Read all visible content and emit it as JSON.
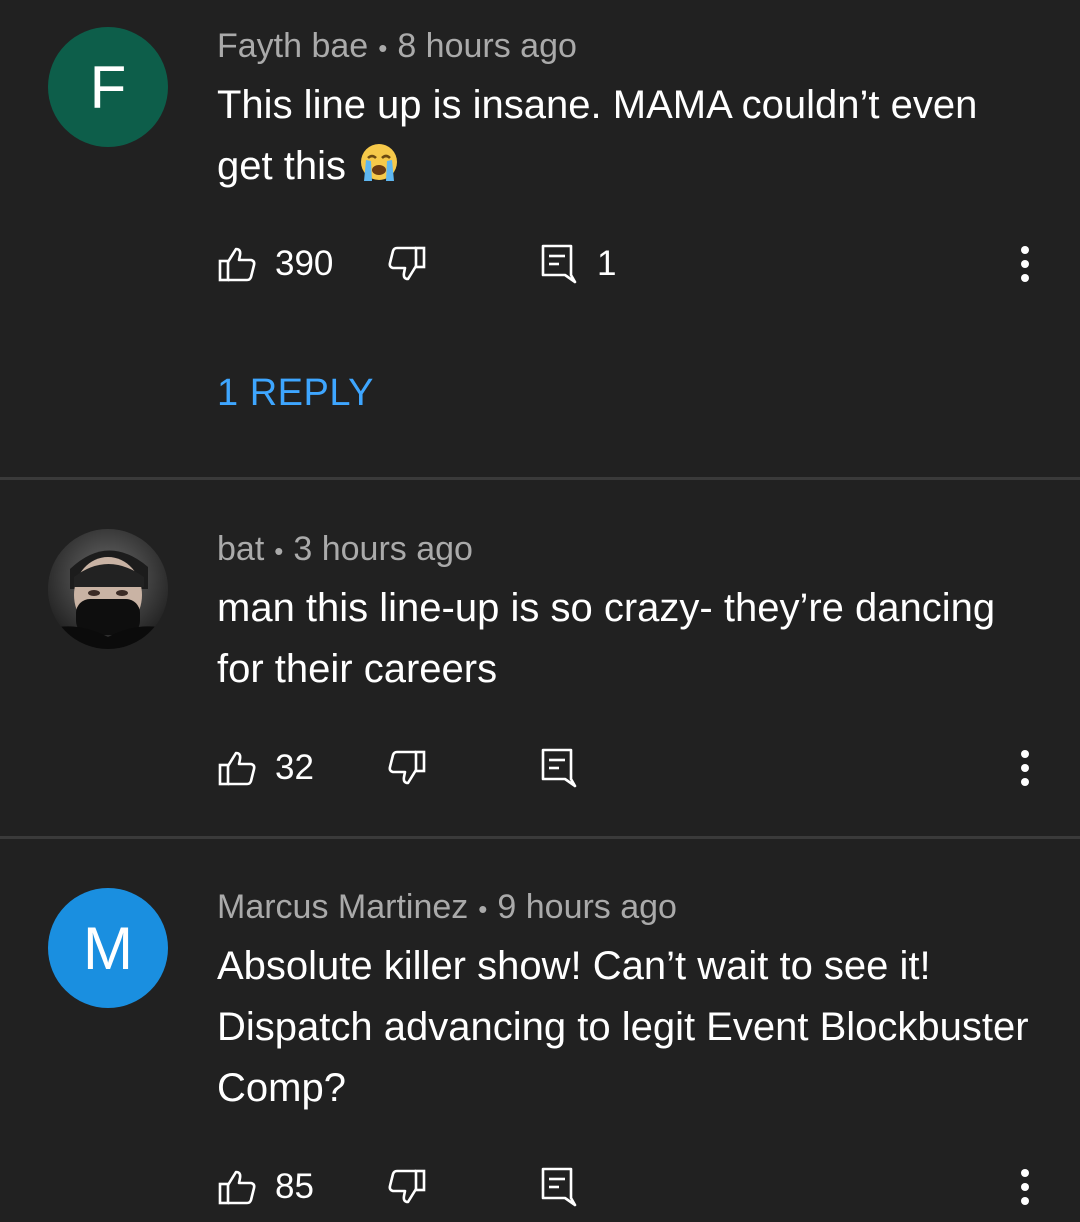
{
  "comments": [
    {
      "author": "Fayth bae",
      "time": "8 hours ago",
      "avatar_letter": "F",
      "avatar_color": "#0d5e4a",
      "text": "This line up is insane. MAMA couldn’t even get this",
      "emoji": "loudly-crying-face-icon",
      "likes": "390",
      "replies_count": "1",
      "view_replies": "1 REPLY"
    },
    {
      "author": "bat",
      "time": "3 hours ago",
      "avatar_type": "photo",
      "text": "man this line-up is so crazy- they’re dancing for their careers",
      "likes": "32"
    },
    {
      "author": "Marcus Martinez",
      "time": "9 hours ago",
      "avatar_letter": "M",
      "avatar_color": "#1a8fe0",
      "text": "Absolute killer show! Can’t wait to see it! Dispatch advancing to legit Event Blockbuster Comp?",
      "likes": "85"
    }
  ],
  "separator": "•"
}
